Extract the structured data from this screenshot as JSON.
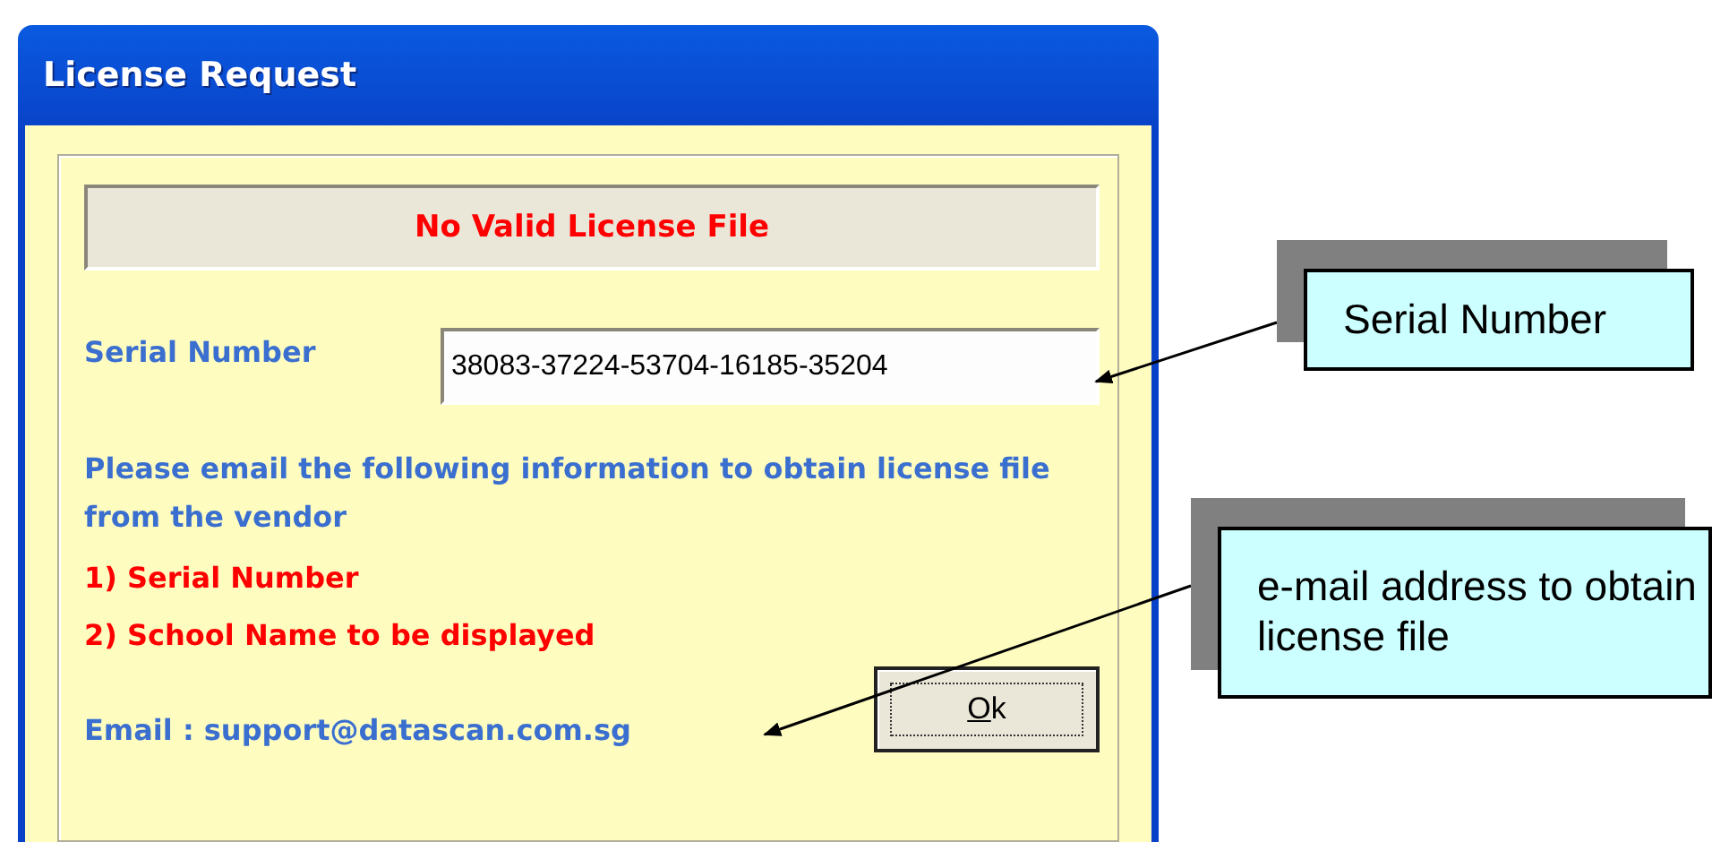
{
  "window": {
    "title": "License Request"
  },
  "banner": "No Valid License File",
  "serial": {
    "label": "Serial Number",
    "value": "38083-37224-53704-16185-35204"
  },
  "instructions": "Please email the following information to obtain license file from the vendor",
  "requirements": [
    "1) Serial Number",
    "2) School Name to be displayed"
  ],
  "email": "Email : support@datascan.com.sg",
  "ok_button": "Ok",
  "callouts": [
    {
      "text": "Serial Number"
    },
    {
      "text": "e-mail address to obtain license file"
    }
  ]
}
